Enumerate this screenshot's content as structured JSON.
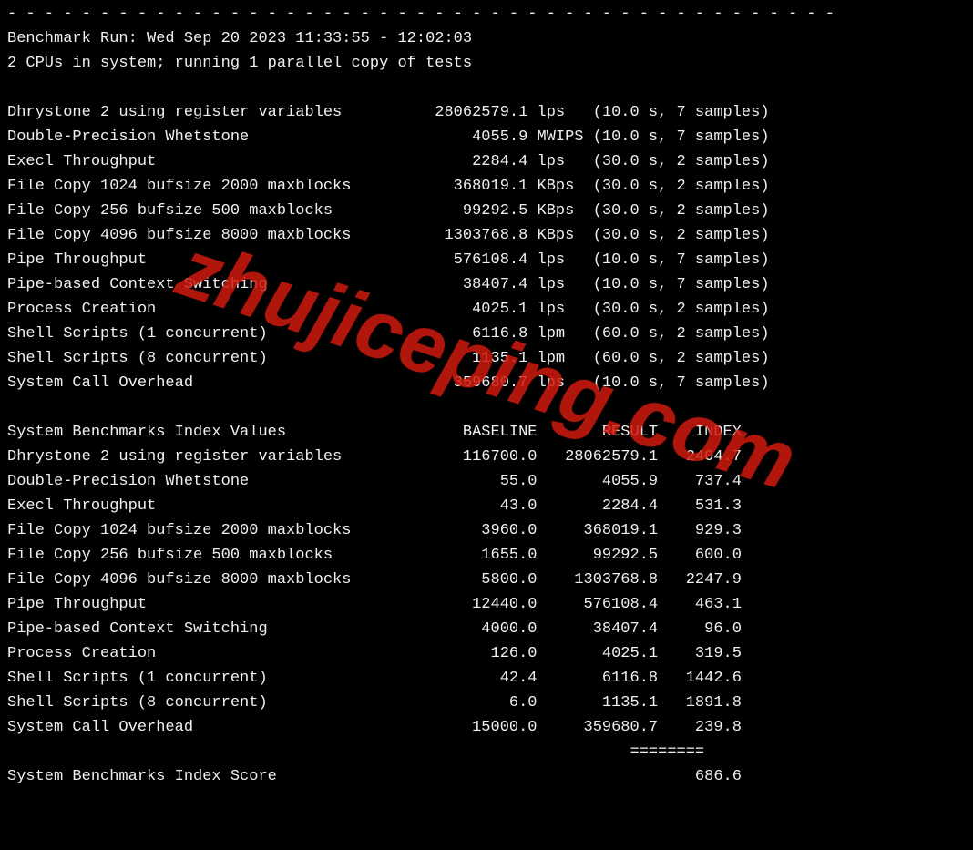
{
  "separator": "- - - - - - - - - - - - - - - - - - - - - - - - - - - - - - - - - - - - - - - - - - - - -",
  "run_header": "Benchmark Run: Wed Sep 20 2023 11:33:55 - 12:02:03",
  "cpu_line": "2 CPUs in system; running 1 parallel copy of tests",
  "watermark": "zhujiceping.com",
  "raw": [
    {
      "name": "Dhrystone 2 using register variables",
      "value": "28062579.1",
      "unit": "lps",
      "time": "10.0",
      "samples": "7"
    },
    {
      "name": "Double-Precision Whetstone",
      "value": "4055.9",
      "unit": "MWIPS",
      "time": "10.0",
      "samples": "7"
    },
    {
      "name": "Execl Throughput",
      "value": "2284.4",
      "unit": "lps",
      "time": "30.0",
      "samples": "2"
    },
    {
      "name": "File Copy 1024 bufsize 2000 maxblocks",
      "value": "368019.1",
      "unit": "KBps",
      "time": "30.0",
      "samples": "2"
    },
    {
      "name": "File Copy 256 bufsize 500 maxblocks",
      "value": "99292.5",
      "unit": "KBps",
      "time": "30.0",
      "samples": "2"
    },
    {
      "name": "File Copy 4096 bufsize 8000 maxblocks",
      "value": "1303768.8",
      "unit": "KBps",
      "time": "30.0",
      "samples": "2"
    },
    {
      "name": "Pipe Throughput",
      "value": "576108.4",
      "unit": "lps",
      "time": "10.0",
      "samples": "7"
    },
    {
      "name": "Pipe-based Context Switching",
      "value": "38407.4",
      "unit": "lps",
      "time": "10.0",
      "samples": "7"
    },
    {
      "name": "Process Creation",
      "value": "4025.1",
      "unit": "lps",
      "time": "30.0",
      "samples": "2"
    },
    {
      "name": "Shell Scripts (1 concurrent)",
      "value": "6116.8",
      "unit": "lpm",
      "time": "60.0",
      "samples": "2"
    },
    {
      "name": "Shell Scripts (8 concurrent)",
      "value": "1135.1",
      "unit": "lpm",
      "time": "60.0",
      "samples": "2"
    },
    {
      "name": "System Call Overhead",
      "value": "359680.7",
      "unit": "lps",
      "time": "10.0",
      "samples": "7"
    }
  ],
  "index_header": {
    "title": "System Benchmarks Index Values",
    "c1": "BASELINE",
    "c2": "RESULT",
    "c3": "INDEX"
  },
  "index": [
    {
      "name": "Dhrystone 2 using register variables",
      "baseline": "116700.0",
      "result": "28062579.1",
      "index": "2404.7"
    },
    {
      "name": "Double-Precision Whetstone",
      "baseline": "55.0",
      "result": "4055.9",
      "index": "737.4"
    },
    {
      "name": "Execl Throughput",
      "baseline": "43.0",
      "result": "2284.4",
      "index": "531.3"
    },
    {
      "name": "File Copy 1024 bufsize 2000 maxblocks",
      "baseline": "3960.0",
      "result": "368019.1",
      "index": "929.3"
    },
    {
      "name": "File Copy 256 bufsize 500 maxblocks",
      "baseline": "1655.0",
      "result": "99292.5",
      "index": "600.0"
    },
    {
      "name": "File Copy 4096 bufsize 8000 maxblocks",
      "baseline": "5800.0",
      "result": "1303768.8",
      "index": "2247.9"
    },
    {
      "name": "Pipe Throughput",
      "baseline": "12440.0",
      "result": "576108.4",
      "index": "463.1"
    },
    {
      "name": "Pipe-based Context Switching",
      "baseline": "4000.0",
      "result": "38407.4",
      "index": "96.0"
    },
    {
      "name": "Process Creation",
      "baseline": "126.0",
      "result": "4025.1",
      "index": "319.5"
    },
    {
      "name": "Shell Scripts (1 concurrent)",
      "baseline": "42.4",
      "result": "6116.8",
      "index": "1442.6"
    },
    {
      "name": "Shell Scripts (8 concurrent)",
      "baseline": "6.0",
      "result": "1135.1",
      "index": "1891.8"
    },
    {
      "name": "System Call Overhead",
      "baseline": "15000.0",
      "result": "359680.7",
      "index": "239.8"
    }
  ],
  "score_rule": "                                                                   ========",
  "score_label": "System Benchmarks Index Score",
  "score_value": "686.6"
}
